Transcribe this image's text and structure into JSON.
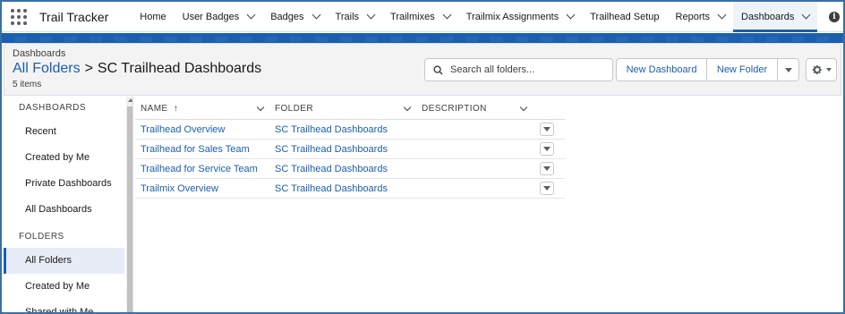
{
  "app": {
    "name": "Trail Tracker"
  },
  "nav": {
    "items": [
      {
        "label": "Home",
        "has_menu": false,
        "active": false
      },
      {
        "label": "User Badges",
        "has_menu": true,
        "active": false
      },
      {
        "label": "Badges",
        "has_menu": true,
        "active": false
      },
      {
        "label": "Trails",
        "has_menu": true,
        "active": false
      },
      {
        "label": "Trailmixes",
        "has_menu": true,
        "active": false
      },
      {
        "label": "Trailmix Assignments",
        "has_menu": true,
        "active": false
      },
      {
        "label": "Trailhead Setup",
        "has_menu": false,
        "active": false
      },
      {
        "label": "Reports",
        "has_menu": true,
        "active": false
      },
      {
        "label": "Dashboards",
        "has_menu": true,
        "active": true
      }
    ]
  },
  "header": {
    "breadcrumb": "Dashboards",
    "title_link": "All Folders",
    "title_separator": ">",
    "title_current": "SC Trailhead Dashboards",
    "item_count": "5 items",
    "search_placeholder": "Search all folders...",
    "new_dashboard": "New Dashboard",
    "new_folder": "New Folder"
  },
  "sidebar": {
    "dashboards_heading": "DASHBOARDS",
    "dashboard_items": [
      "Recent",
      "Created by Me",
      "Private Dashboards",
      "All Dashboards"
    ],
    "folders_heading": "FOLDERS",
    "folder_items": [
      "All Folders",
      "Created by Me",
      "Shared with Me"
    ],
    "selected": "All Folders"
  },
  "table": {
    "columns": [
      "NAME",
      "FOLDER",
      "DESCRIPTION"
    ],
    "sort_indicator": "↑",
    "rows": [
      {
        "name": "Trailhead Overview",
        "folder": "SC Trailhead Dashboards",
        "description": ""
      },
      {
        "name": "Trailhead for Sales Team",
        "folder": "SC Trailhead Dashboards",
        "description": ""
      },
      {
        "name": "Trailhead for Service Team",
        "folder": "SC Trailhead Dashboards",
        "description": ""
      },
      {
        "name": "Trailmix Overview",
        "folder": "SC Trailhead Dashboards",
        "description": ""
      }
    ]
  },
  "colors": {
    "brand": "#1b5fae",
    "link": "#1b5fae",
    "header_bg": "#f3f3f3"
  },
  "icons": [
    "app-launcher-icon",
    "chevron-down-icon",
    "info-icon",
    "search-icon",
    "gear-icon",
    "sort-up-icon"
  ]
}
